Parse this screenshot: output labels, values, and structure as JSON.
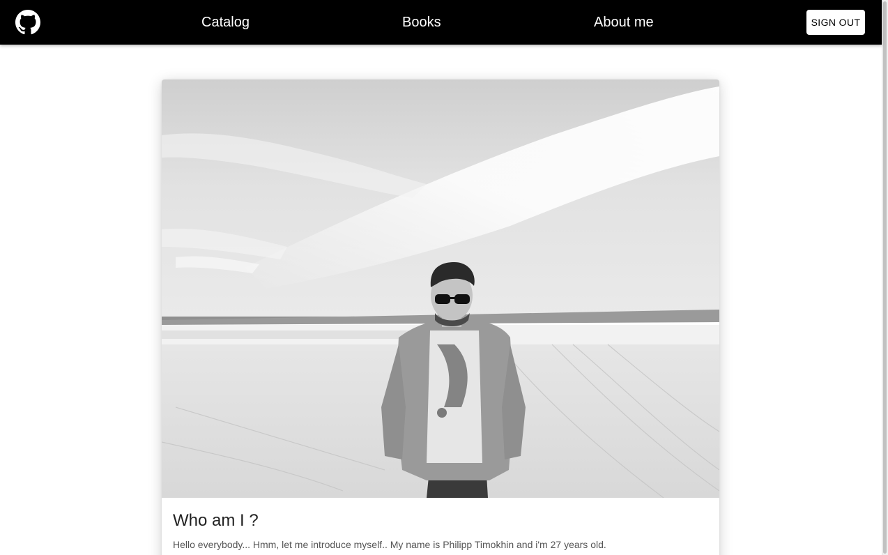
{
  "header": {
    "logo_icon": "github-icon",
    "nav": [
      {
        "label": "Catalog"
      },
      {
        "label": "Books"
      },
      {
        "label": "About me"
      }
    ],
    "signout_label": "SIGN OUT"
  },
  "card": {
    "title": "Who am I ?",
    "text": "Hello everybody... Hmm, let me introduce myself.. My name is Philipp Timokhin and i'm 27 years old."
  },
  "colors": {
    "appbar": "#000000",
    "nav_text": "#ffffff",
    "button_bg": "#ffffff",
    "page_bg": "#ffffff"
  }
}
